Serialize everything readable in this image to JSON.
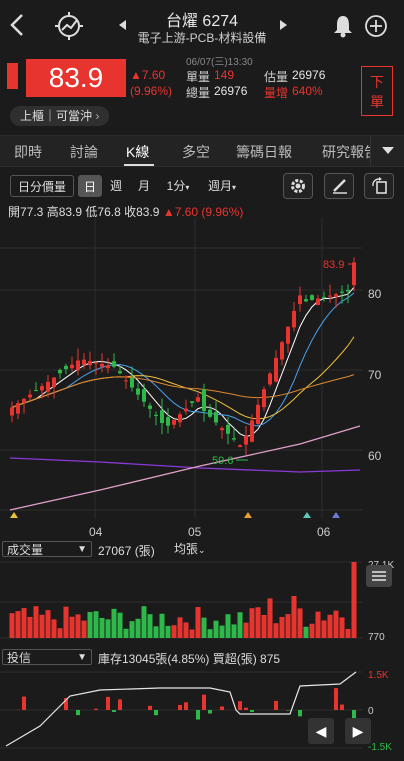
{
  "header": {
    "back_icon": "chevron-left",
    "title": "台燿 6274",
    "subtitle": "電子上游-PCB-材料設備"
  },
  "quote": {
    "price": "83.9",
    "change": "▲7.60",
    "change_pct": "(9.96%)",
    "timestamp": "06/07(三)13:30",
    "single_vol_label": "單量",
    "single_vol": "149",
    "total_vol_label": "總量",
    "total_vol": "26976",
    "est_label": "估量",
    "est_vol": "26976",
    "increase_label": "量增",
    "increase": "640%",
    "order_button": "下單",
    "market_tag": "上櫃｜可當沖"
  },
  "tabs": [
    "即時",
    "討論",
    "K線",
    "多空",
    "籌碼日報",
    "研究報告"
  ],
  "active_tab": "K線",
  "toolbar": {
    "intraday": "日分價量",
    "day": "日",
    "week": "週",
    "month": "月",
    "minute": "1分",
    "period": "週月"
  },
  "ohlc": {
    "open": "開77.3",
    "high": "高83.9",
    "low": "低76.8",
    "close": "收83.9",
    "change": "▲7.60 (9.96%)"
  },
  "main_chart": {
    "y_ticks": [
      "80",
      "70",
      "60"
    ],
    "x_ticks": [
      "04",
      "05",
      "06"
    ],
    "high_label": "83.9",
    "low_label": "59.6"
  },
  "volume": {
    "selector": "成交量",
    "value": "27067 (張)",
    "avg_selector": "均張",
    "max_label": "27.1K",
    "min_label": "770"
  },
  "inst": {
    "selector": "投信",
    "info": "庫存13045張(4.85%)  買超(張) 875",
    "top_label": "1.5K",
    "mid_label": "0",
    "bot_label": "-1.5K"
  },
  "colors": {
    "up": "#e8342f",
    "down": "#2fb84a",
    "accent": "#e8342f"
  }
}
